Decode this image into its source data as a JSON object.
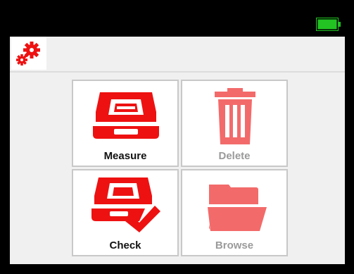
{
  "theme": {
    "accent_active": "#ee1111",
    "accent_inactive": "#f36a6a",
    "battery_color": "#22c322"
  },
  "status_bar": {
    "battery_icon": "battery-full-icon"
  },
  "header": {
    "settings_icon": "gears-icon"
  },
  "menu": {
    "tiles": [
      {
        "label": "Measure",
        "icon": "device-icon",
        "enabled": true
      },
      {
        "label": "Delete",
        "icon": "trash-icon",
        "enabled": false
      },
      {
        "label": "Check",
        "icon": "device-check-icon",
        "enabled": true
      },
      {
        "label": "Browse",
        "icon": "folder-icon",
        "enabled": false
      }
    ]
  }
}
